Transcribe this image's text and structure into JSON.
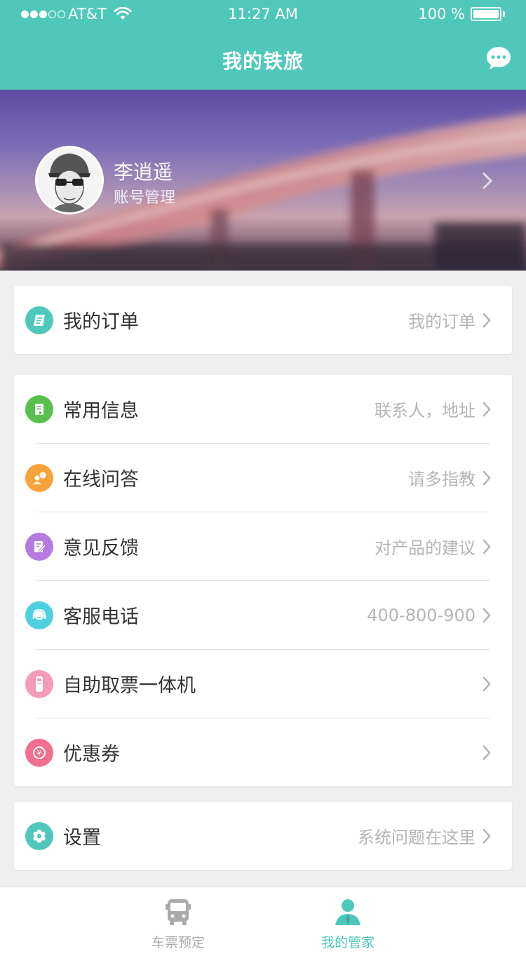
{
  "status": {
    "carrier": "AT&T",
    "time": "11:27 AM",
    "battery": "100 %"
  },
  "header": {
    "title": "我的铁旅"
  },
  "profile": {
    "name": "李逍遥",
    "subtitle": "账号管理"
  },
  "orders": {
    "label": "我的订单",
    "value": "我的订单"
  },
  "menu": [
    {
      "label": "常用信息",
      "value": "联系人，地址",
      "icon": "info-icon",
      "color": "#5bbf4e"
    },
    {
      "label": "在线问答",
      "value": "请多指教",
      "icon": "qa-icon",
      "color": "#f7a33b"
    },
    {
      "label": "意见反馈",
      "value": "对产品的建议",
      "icon": "feedback-icon",
      "color": "#b57be0"
    },
    {
      "label": "客服电话",
      "value": "400-800-900",
      "icon": "headset-icon",
      "color": "#4fd0e0"
    },
    {
      "label": "自助取票一体机",
      "value": "",
      "icon": "ticket-machine-icon",
      "color": "#f59ab8"
    },
    {
      "label": "优惠券",
      "value": "",
      "icon": "coupon-icon",
      "color": "#f26f8e"
    }
  ],
  "settings": {
    "label": "设置",
    "value": "系统问题在这里"
  },
  "tabs": {
    "tickets": "车票预定",
    "mine": "我的管家"
  },
  "colors": {
    "accent": "#4fc8bb",
    "inactive": "#aaaaaa"
  }
}
